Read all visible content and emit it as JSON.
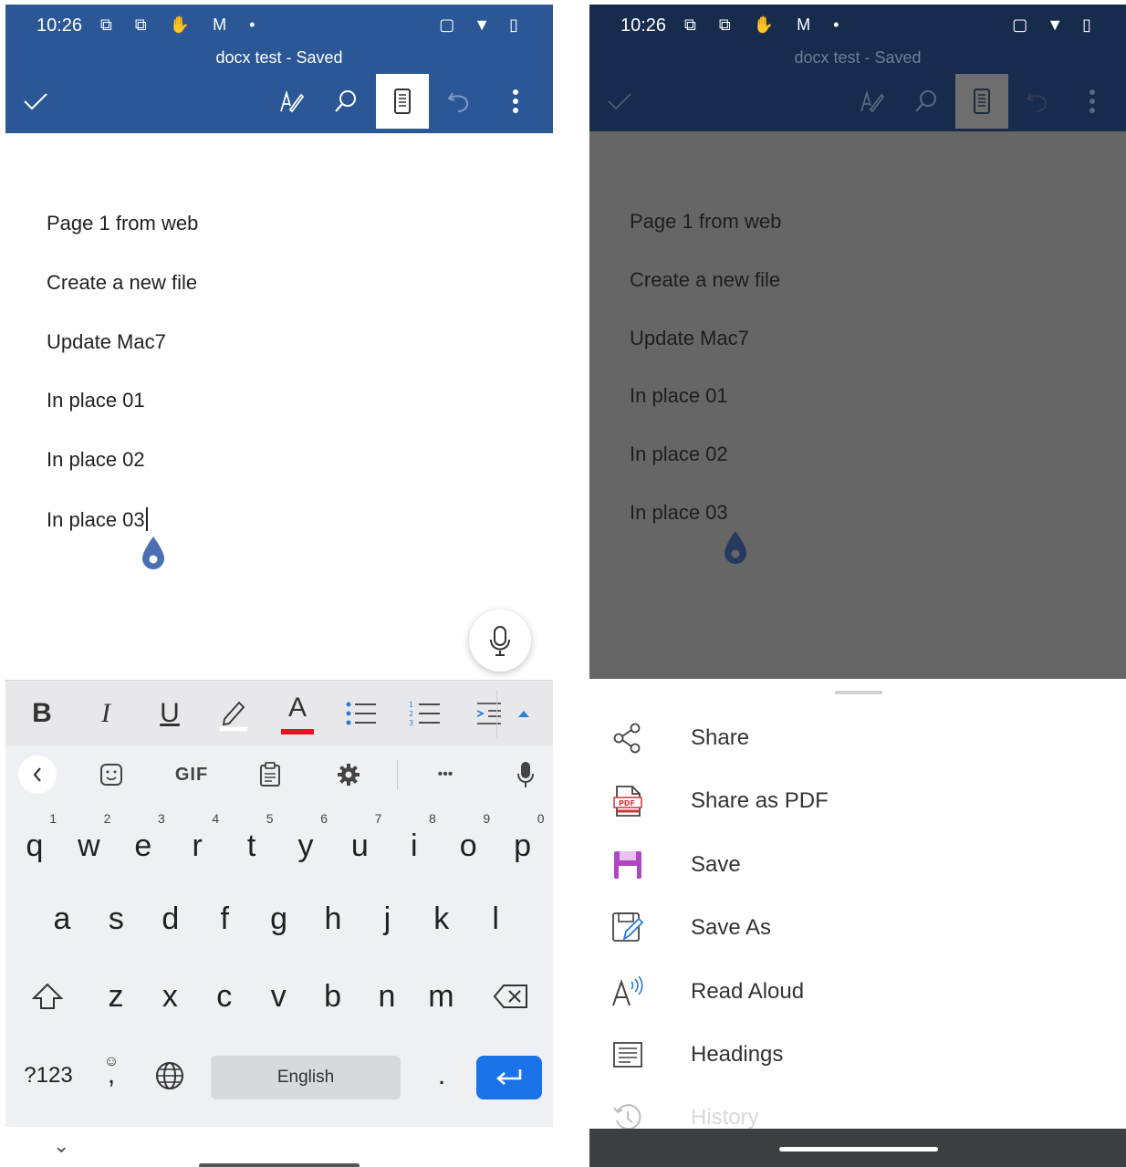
{
  "status": {
    "time": "10:26",
    "left_icons": "⧉ ⧉ ✋ M •",
    "right_icons": "▢ ▼ ▯"
  },
  "document": {
    "title": "docx test - Saved",
    "paragraphs": [
      "Page 1 from web",
      "Create a new file",
      "Update Mac7",
      "In place 01",
      "In place 02",
      "In place 03"
    ]
  },
  "toolbar": {
    "icons": [
      "checkmark-icon",
      "draw-pen-icon",
      "search-icon",
      "mobile-view-icon",
      "undo-icon",
      "more-vert-icon"
    ]
  },
  "format_bar": {
    "bold": "B",
    "italic": "I",
    "underline": "U",
    "font_color": "A"
  },
  "keyboard": {
    "toolbar_gif": "GIF",
    "toolbar_more": "•••",
    "row1": [
      {
        "k": "q",
        "h": "1"
      },
      {
        "k": "w",
        "h": "2"
      },
      {
        "k": "e",
        "h": "3"
      },
      {
        "k": "r",
        "h": "4"
      },
      {
        "k": "t",
        "h": "5"
      },
      {
        "k": "y",
        "h": "6"
      },
      {
        "k": "u",
        "h": "7"
      },
      {
        "k": "i",
        "h": "8"
      },
      {
        "k": "o",
        "h": "9"
      },
      {
        "k": "p",
        "h": "0"
      }
    ],
    "row2": [
      "a",
      "s",
      "d",
      "f",
      "g",
      "h",
      "j",
      "k",
      "l"
    ],
    "row3": [
      "z",
      "x",
      "c",
      "v",
      "b",
      "n",
      "m"
    ],
    "symbols_key": "?123",
    "comma_key": ",",
    "period_key": ".",
    "space_label": "English",
    "nav_down": "⌄"
  },
  "sheet": {
    "items": [
      {
        "label": "Share",
        "icon": "share-icon"
      },
      {
        "label": "Share as PDF",
        "icon": "pdf-icon"
      },
      {
        "label": "Save",
        "icon": "save-icon"
      },
      {
        "label": "Save As",
        "icon": "save-as-icon"
      },
      {
        "label": "Read Aloud",
        "icon": "read-aloud-icon"
      },
      {
        "label": "Headings",
        "icon": "headings-icon"
      },
      {
        "label": "History",
        "icon": "history-icon"
      }
    ]
  },
  "colors": {
    "header_active": "#2b5797",
    "header_dimmed": "#172b4d",
    "doc_dimmed": "#666666",
    "enter_key": "#1a73e8",
    "font_color_underline": "#e81123",
    "save_icon": "#b146c2"
  }
}
